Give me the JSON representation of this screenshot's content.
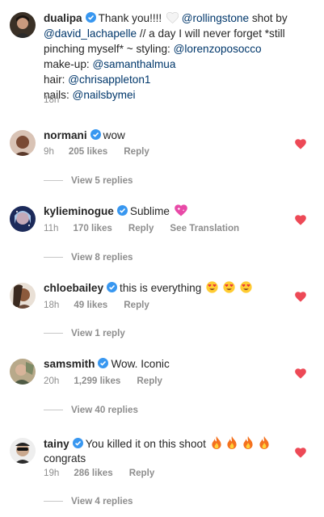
{
  "caption": {
    "username": "dualipa",
    "parts": [
      {
        "t": "text",
        "v": "Thank you!!!! "
      },
      {
        "t": "emoji",
        "v": "white-heart"
      },
      {
        "t": "text",
        "v": " "
      },
      {
        "t": "mention",
        "v": "@rollingstone"
      },
      {
        "t": "text",
        "v": " shot by "
      },
      {
        "t": "mention",
        "v": "@david_lachapelle"
      },
      {
        "t": "text",
        "v": " // a day I will never forget *still pinching myself* ~ styling: "
      },
      {
        "t": "mention",
        "v": "@lorenzoposocco"
      },
      {
        "t": "br"
      },
      {
        "t": "text",
        "v": "make-up: "
      },
      {
        "t": "mention",
        "v": "@samanthalmua"
      },
      {
        "t": "br"
      },
      {
        "t": "text",
        "v": "hair: "
      },
      {
        "t": "mention",
        "v": "@chrisappleton1"
      },
      {
        "t": "br"
      },
      {
        "t": "text",
        "v": "nails: "
      },
      {
        "t": "mention",
        "v": "@nailsbymei"
      }
    ],
    "time": "18h"
  },
  "comments": [
    {
      "username": "normani",
      "text": "wow",
      "emojis": [],
      "time": "9h",
      "likes": "205 likes",
      "reply": "Reply",
      "translation": "",
      "view_replies": "View 5 replies"
    },
    {
      "username": "kylieminogue",
      "text": "Sublime",
      "emojis": [
        "sparkling-heart"
      ],
      "time": "11h",
      "likes": "170 likes",
      "reply": "Reply",
      "translation": "See Translation",
      "view_replies": "View 8 replies"
    },
    {
      "username": "chloebailey",
      "text": "this is everything",
      "emojis": [
        "heart-eyes",
        "heart-eyes",
        "heart-eyes"
      ],
      "time": "18h",
      "likes": "49 likes",
      "reply": "Reply",
      "translation": "",
      "view_replies": "View 1 reply"
    },
    {
      "username": "samsmith",
      "text": "Wow. Iconic",
      "emojis": [],
      "time": "20h",
      "likes": "1,299 likes",
      "reply": "Reply",
      "translation": "",
      "view_replies": "View 40 replies"
    },
    {
      "username": "tainy",
      "text": "You killed it on this shoot",
      "text2": "congrats",
      "emojis": [
        "fire",
        "fire",
        "fire",
        "fire"
      ],
      "time": "19h",
      "likes": "286 likes",
      "reply": "Reply",
      "translation": "",
      "view_replies": "View 4 replies"
    }
  ],
  "colors": {
    "heart": "#ed4956",
    "verified": "#3897f0",
    "mention": "#00376b",
    "meta": "#8e8e8e"
  }
}
